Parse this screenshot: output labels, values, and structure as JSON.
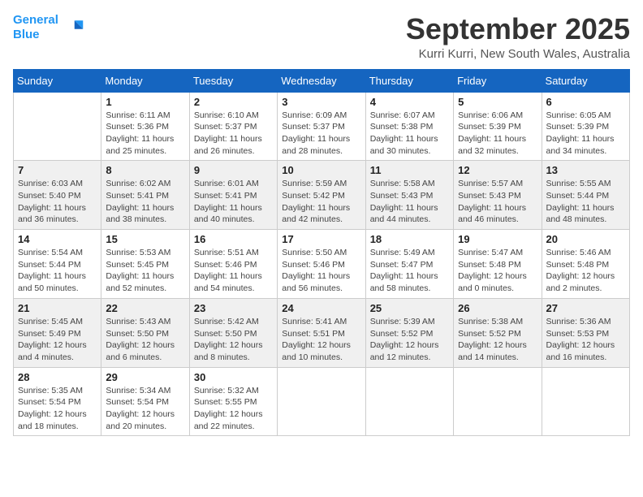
{
  "logo": {
    "line1": "General",
    "line2": "Blue"
  },
  "title": "September 2025",
  "location": "Kurri Kurri, New South Wales, Australia",
  "columns": [
    "Sunday",
    "Monday",
    "Tuesday",
    "Wednesday",
    "Thursday",
    "Friday",
    "Saturday"
  ],
  "weeks": [
    [
      {
        "day": "",
        "info": ""
      },
      {
        "day": "1",
        "info": "Sunrise: 6:11 AM\nSunset: 5:36 PM\nDaylight: 11 hours\nand 25 minutes."
      },
      {
        "day": "2",
        "info": "Sunrise: 6:10 AM\nSunset: 5:37 PM\nDaylight: 11 hours\nand 26 minutes."
      },
      {
        "day": "3",
        "info": "Sunrise: 6:09 AM\nSunset: 5:37 PM\nDaylight: 11 hours\nand 28 minutes."
      },
      {
        "day": "4",
        "info": "Sunrise: 6:07 AM\nSunset: 5:38 PM\nDaylight: 11 hours\nand 30 minutes."
      },
      {
        "day": "5",
        "info": "Sunrise: 6:06 AM\nSunset: 5:39 PM\nDaylight: 11 hours\nand 32 minutes."
      },
      {
        "day": "6",
        "info": "Sunrise: 6:05 AM\nSunset: 5:39 PM\nDaylight: 11 hours\nand 34 minutes."
      }
    ],
    [
      {
        "day": "7",
        "info": "Sunrise: 6:03 AM\nSunset: 5:40 PM\nDaylight: 11 hours\nand 36 minutes."
      },
      {
        "day": "8",
        "info": "Sunrise: 6:02 AM\nSunset: 5:41 PM\nDaylight: 11 hours\nand 38 minutes."
      },
      {
        "day": "9",
        "info": "Sunrise: 6:01 AM\nSunset: 5:41 PM\nDaylight: 11 hours\nand 40 minutes."
      },
      {
        "day": "10",
        "info": "Sunrise: 5:59 AM\nSunset: 5:42 PM\nDaylight: 11 hours\nand 42 minutes."
      },
      {
        "day": "11",
        "info": "Sunrise: 5:58 AM\nSunset: 5:43 PM\nDaylight: 11 hours\nand 44 minutes."
      },
      {
        "day": "12",
        "info": "Sunrise: 5:57 AM\nSunset: 5:43 PM\nDaylight: 11 hours\nand 46 minutes."
      },
      {
        "day": "13",
        "info": "Sunrise: 5:55 AM\nSunset: 5:44 PM\nDaylight: 11 hours\nand 48 minutes."
      }
    ],
    [
      {
        "day": "14",
        "info": "Sunrise: 5:54 AM\nSunset: 5:44 PM\nDaylight: 11 hours\nand 50 minutes."
      },
      {
        "day": "15",
        "info": "Sunrise: 5:53 AM\nSunset: 5:45 PM\nDaylight: 11 hours\nand 52 minutes."
      },
      {
        "day": "16",
        "info": "Sunrise: 5:51 AM\nSunset: 5:46 PM\nDaylight: 11 hours\nand 54 minutes."
      },
      {
        "day": "17",
        "info": "Sunrise: 5:50 AM\nSunset: 5:46 PM\nDaylight: 11 hours\nand 56 minutes."
      },
      {
        "day": "18",
        "info": "Sunrise: 5:49 AM\nSunset: 5:47 PM\nDaylight: 11 hours\nand 58 minutes."
      },
      {
        "day": "19",
        "info": "Sunrise: 5:47 AM\nSunset: 5:48 PM\nDaylight: 12 hours\nand 0 minutes."
      },
      {
        "day": "20",
        "info": "Sunrise: 5:46 AM\nSunset: 5:48 PM\nDaylight: 12 hours\nand 2 minutes."
      }
    ],
    [
      {
        "day": "21",
        "info": "Sunrise: 5:45 AM\nSunset: 5:49 PM\nDaylight: 12 hours\nand 4 minutes."
      },
      {
        "day": "22",
        "info": "Sunrise: 5:43 AM\nSunset: 5:50 PM\nDaylight: 12 hours\nand 6 minutes."
      },
      {
        "day": "23",
        "info": "Sunrise: 5:42 AM\nSunset: 5:50 PM\nDaylight: 12 hours\nand 8 minutes."
      },
      {
        "day": "24",
        "info": "Sunrise: 5:41 AM\nSunset: 5:51 PM\nDaylight: 12 hours\nand 10 minutes."
      },
      {
        "day": "25",
        "info": "Sunrise: 5:39 AM\nSunset: 5:52 PM\nDaylight: 12 hours\nand 12 minutes."
      },
      {
        "day": "26",
        "info": "Sunrise: 5:38 AM\nSunset: 5:52 PM\nDaylight: 12 hours\nand 14 minutes."
      },
      {
        "day": "27",
        "info": "Sunrise: 5:36 AM\nSunset: 5:53 PM\nDaylight: 12 hours\nand 16 minutes."
      }
    ],
    [
      {
        "day": "28",
        "info": "Sunrise: 5:35 AM\nSunset: 5:54 PM\nDaylight: 12 hours\nand 18 minutes."
      },
      {
        "day": "29",
        "info": "Sunrise: 5:34 AM\nSunset: 5:54 PM\nDaylight: 12 hours\nand 20 minutes."
      },
      {
        "day": "30",
        "info": "Sunrise: 5:32 AM\nSunset: 5:55 PM\nDaylight: 12 hours\nand 22 minutes."
      },
      {
        "day": "",
        "info": ""
      },
      {
        "day": "",
        "info": ""
      },
      {
        "day": "",
        "info": ""
      },
      {
        "day": "",
        "info": ""
      }
    ]
  ]
}
